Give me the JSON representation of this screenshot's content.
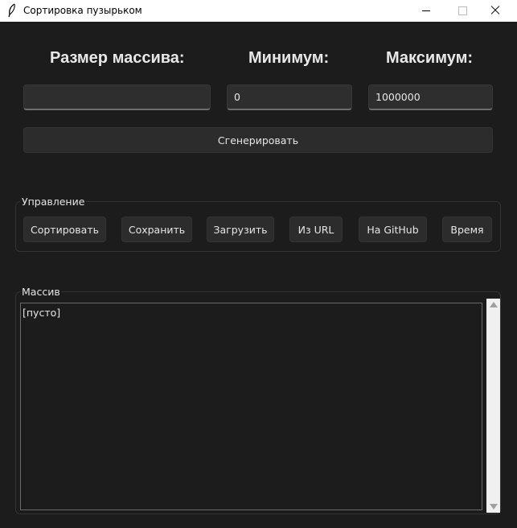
{
  "window": {
    "title": "Сортировка пузырьком",
    "icon": "feather-icon"
  },
  "params": {
    "size_label": "Размер массива:",
    "min_label": "Минимум:",
    "max_label": "Максимум:",
    "size_value": "",
    "min_value": "0",
    "max_value": "1000000"
  },
  "generate_label": "Сгенерировать",
  "control": {
    "title": "Управление",
    "buttons": [
      "Сортировать",
      "Сохранить",
      "Загрузить",
      "Из URL",
      "На GitHub",
      "Время"
    ]
  },
  "array": {
    "title": "Массив",
    "content": "[пусто]"
  },
  "colors": {
    "background": "#1c1c1c",
    "field": "#2e2e2e",
    "button": "#2c2c2c",
    "text": "#e6e6e6"
  }
}
